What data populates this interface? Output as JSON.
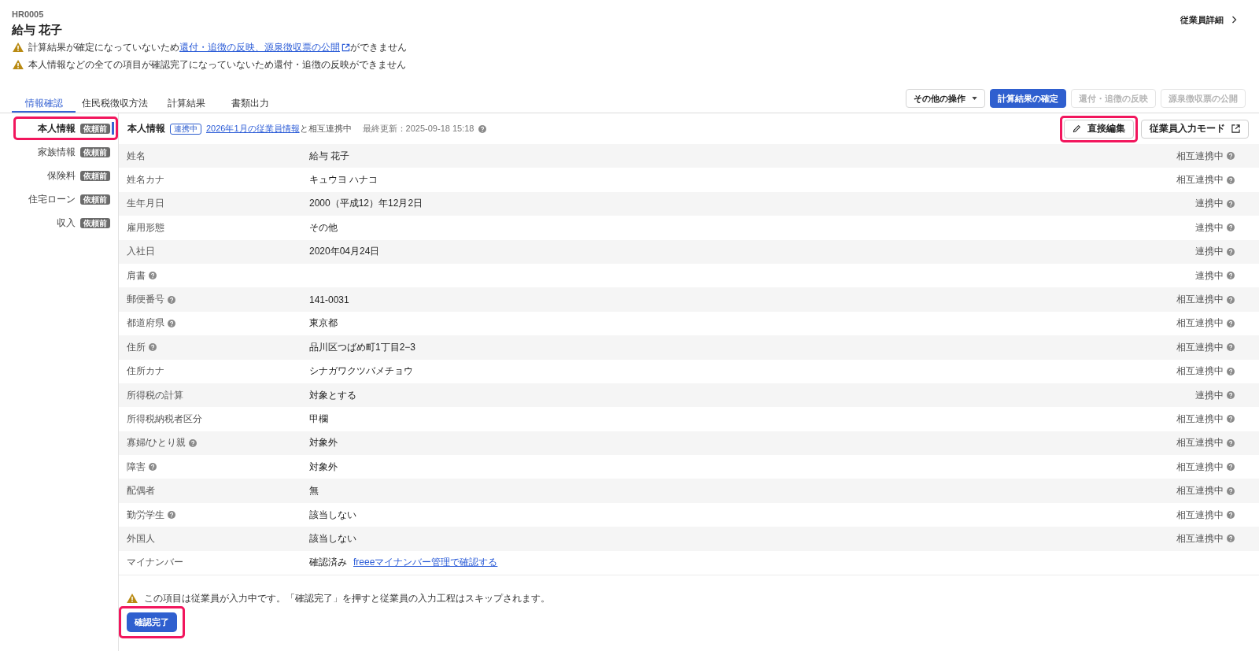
{
  "employee": {
    "code": "HR0005",
    "name": "給与 花子"
  },
  "detail_link": "従業員詳細",
  "warnings": [
    {
      "text": "計算結果が確定になっていないため",
      "link": "還付・追徴の反映、源泉徴収票の公開",
      "after": "ができません"
    },
    {
      "text": "本人情報などの全ての項目が確認完了になっていないため還付・追徴の反映ができません"
    }
  ],
  "tabs": [
    {
      "label": "情報確認",
      "selected": true
    },
    {
      "label": "住民税徴収方法",
      "selected": false
    },
    {
      "label": "計算結果",
      "selected": false
    },
    {
      "label": "書類出力",
      "selected": false
    }
  ],
  "actions": [
    {
      "label": "その他の操作",
      "kind": "dropdown",
      "disabled": false
    },
    {
      "label": "計算結果の確定",
      "kind": "primary",
      "disabled": false
    },
    {
      "label": "還付・追徴の反映",
      "kind": "secondary",
      "disabled": true
    },
    {
      "label": "源泉徴収票の公開",
      "kind": "secondary",
      "disabled": true
    }
  ],
  "sidebar": {
    "items": [
      {
        "label": "本人情報",
        "badge": "依頼前",
        "selected": true,
        "highlighted": true
      },
      {
        "label": "家族情報",
        "badge": "依頼前",
        "selected": false,
        "highlighted": false
      },
      {
        "label": "保険料",
        "badge": "依頼前",
        "selected": false,
        "highlighted": false
      },
      {
        "label": "住宅ローン",
        "badge": "依頼前",
        "selected": false,
        "highlighted": false
      },
      {
        "label": "収入",
        "badge": "依頼前",
        "selected": false,
        "highlighted": false
      }
    ]
  },
  "section": {
    "title": "本人情報",
    "status_badge": "連携中",
    "sync_link": "2026年1月の従業員情報",
    "sync_text": "と相互連携中",
    "last_updated": "最終更新：2025-09-18 15:18",
    "buttons": [
      {
        "label": "直接編集",
        "kind": "edit",
        "highlighted": true
      },
      {
        "label": "従業員入力モード",
        "kind": "external",
        "highlighted": false
      }
    ]
  },
  "rows": [
    {
      "label": "姓名",
      "help": false,
      "value": "給与 花子",
      "status": "相互連携中"
    },
    {
      "label": "姓名カナ",
      "help": false,
      "value": "キュウヨ ハナコ",
      "status": "相互連携中"
    },
    {
      "label": "生年月日",
      "help": false,
      "value": "2000（平成12）年12月2日",
      "status": "連携中"
    },
    {
      "label": "雇用形態",
      "help": false,
      "value": "その他",
      "status": "連携中"
    },
    {
      "label": "入社日",
      "help": false,
      "value": "2020年04月24日",
      "status": "連携中"
    },
    {
      "label": "肩書",
      "help": true,
      "status": "連携中"
    },
    {
      "label": "郵便番号",
      "help": true,
      "value": "141-0031",
      "status": "相互連携中"
    },
    {
      "label": "都道府県",
      "help": true,
      "value": "東京都",
      "status": "相互連携中"
    },
    {
      "label": "住所",
      "help": true,
      "value": "品川区つばめ町1丁目2−3",
      "status": "相互連携中"
    },
    {
      "label": "住所カナ",
      "help": false,
      "value": "シナガワクツバメチョウ",
      "status": "相互連携中"
    },
    {
      "label": "所得税の計算",
      "help": false,
      "value": "対象とする",
      "status": "連携中"
    },
    {
      "label": "所得税納税者区分",
      "help": false,
      "value": "甲欄",
      "status": "相互連携中"
    },
    {
      "label": "寡婦/ひとり親",
      "help": true,
      "value": "対象外",
      "status": "相互連携中"
    },
    {
      "label": "障害",
      "help": true,
      "value": "対象外",
      "status": "相互連携中"
    },
    {
      "label": "配偶者",
      "help": false,
      "value": "無",
      "status": "相互連携中"
    },
    {
      "label": "勤労学生",
      "help": true,
      "value": "該当しない",
      "status": "相互連携中"
    },
    {
      "label": "外国人",
      "help": false,
      "value": "該当しない",
      "status": "相互連携中"
    },
    {
      "label": "マイナンバー",
      "help": false,
      "value": "確認済み",
      "link": "freeeマイナンバー管理で確認する"
    }
  ],
  "footer": {
    "notice": "この項目は従業員が入力中です。「確認完了」を押すと従業員の入力工程はスキップされます。",
    "button": {
      "label": "確認完了",
      "highlighted": true
    }
  }
}
